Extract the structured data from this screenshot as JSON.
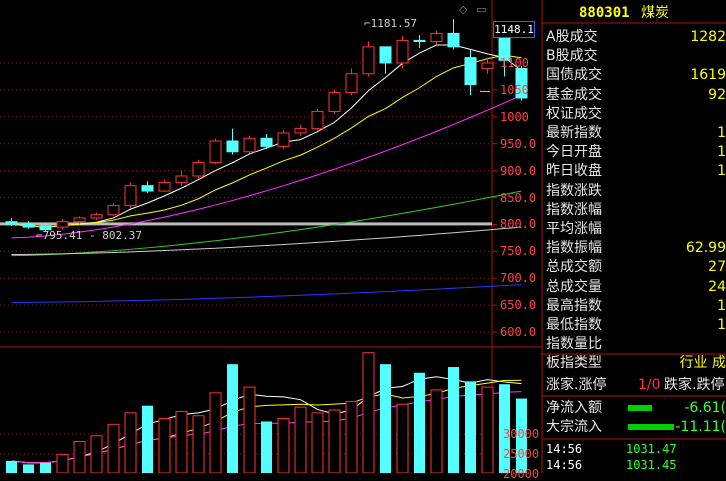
{
  "header": {
    "code": "880301",
    "name": "煤炭"
  },
  "price_badge": "1148.1",
  "high_annotation": "1181.57",
  "range_annotation": "795.41 - 802.37",
  "price_ticks": [
    "1100",
    "1050",
    "1000",
    "950.0",
    "900.0",
    "850.0",
    "800.0",
    "750.0",
    "700.0",
    "650.0",
    "600.0"
  ],
  "volume_ticks": [
    "30000",
    "25000",
    "20000"
  ],
  "stats": [
    {
      "label": "A股成交",
      "value": "1282"
    },
    {
      "label": "B股成交",
      "value": ""
    },
    {
      "label": "国债成交",
      "value": "1619"
    },
    {
      "label": "基金成交",
      "value": "92"
    },
    {
      "label": "权证成交",
      "value": ""
    },
    {
      "label": "最新指数",
      "value": "1"
    },
    {
      "label": "今日开盘",
      "value": "1"
    },
    {
      "label": "昨日收盘",
      "value": "1"
    },
    {
      "label": "指数涨跌",
      "value": ""
    },
    {
      "label": "指数涨幅",
      "value": ""
    },
    {
      "label": "平均涨幅",
      "value": ""
    },
    {
      "label": "指数振幅",
      "value": "62.99"
    },
    {
      "label": "总成交额",
      "value": "27"
    },
    {
      "label": "总成交量",
      "value": "24"
    },
    {
      "label": "最高指数",
      "value": "1"
    },
    {
      "label": "最低指数",
      "value": "1"
    },
    {
      "label": "指数量比",
      "value": ""
    },
    {
      "label": "板指类型",
      "value": "行业 成"
    }
  ],
  "updown": {
    "label": "涨家.涨停",
    "ratio": "1/0",
    "label2": "跌家.跌停"
  },
  "flows": [
    {
      "label": "净流入额",
      "value": "-6.61("
    },
    {
      "label": "大宗流入",
      "value": "-11.11("
    }
  ],
  "trades": [
    {
      "time": "14:56",
      "price": "1031.47"
    },
    {
      "time": "14:56",
      "price": "1031.45"
    }
  ],
  "colors": {
    "up": "#ff3232",
    "down": "#54ffff",
    "grid": "#8b1a1a",
    "yellow": "#ffff00",
    "ma5": "#ffffff",
    "ma10": "#ffff00",
    "ma20": "#ff33ff",
    "ma60": "#33cc33",
    "ma120": "#cccccc",
    "ma250": "#3333ff"
  },
  "chart_data": {
    "type": "candlestick",
    "price_axis": {
      "ticks": [
        1100,
        1050,
        1000,
        950,
        900,
        850,
        800,
        750,
        700,
        650,
        600
      ]
    },
    "candles": [
      {
        "o": 805,
        "h": 812,
        "c": 800,
        "l": 797
      },
      {
        "o": 800,
        "h": 806,
        "c": 795,
        "l": 792
      },
      {
        "o": 797,
        "h": 803,
        "c": 790,
        "l": 786
      },
      {
        "o": 795,
        "h": 810,
        "c": 805,
        "l": 790
      },
      {
        "o": 805,
        "h": 815,
        "c": 812,
        "l": 800
      },
      {
        "o": 812,
        "h": 822,
        "c": 818,
        "l": 808
      },
      {
        "o": 818,
        "h": 840,
        "c": 835,
        "l": 815
      },
      {
        "o": 835,
        "h": 878,
        "c": 872,
        "l": 830
      },
      {
        "o": 872,
        "h": 880,
        "c": 862,
        "l": 858
      },
      {
        "o": 862,
        "h": 882,
        "c": 878,
        "l": 860
      },
      {
        "o": 878,
        "h": 900,
        "c": 890,
        "l": 872
      },
      {
        "o": 890,
        "h": 920,
        "c": 915,
        "l": 885
      },
      {
        "o": 915,
        "h": 960,
        "c": 955,
        "l": 912
      },
      {
        "o": 955,
        "h": 978,
        "c": 935,
        "l": 930
      },
      {
        "o": 935,
        "h": 965,
        "c": 960,
        "l": 932
      },
      {
        "o": 960,
        "h": 968,
        "c": 945,
        "l": 940
      },
      {
        "o": 945,
        "h": 975,
        "c": 970,
        "l": 940
      },
      {
        "o": 970,
        "h": 985,
        "c": 978,
        "l": 965
      },
      {
        "o": 978,
        "h": 1015,
        "c": 1010,
        "l": 975
      },
      {
        "o": 1010,
        "h": 1050,
        "c": 1045,
        "l": 1005
      },
      {
        "o": 1045,
        "h": 1090,
        "c": 1080,
        "l": 1040
      },
      {
        "o": 1080,
        "h": 1140,
        "c": 1130,
        "l": 1075
      },
      {
        "o": 1130,
        "h": 1120,
        "c": 1100,
        "l": 1080
      },
      {
        "o": 1100,
        "h": 1150,
        "c": 1142,
        "l": 1090
      },
      {
        "o": 1142,
        "h": 1152,
        "c": 1140,
        "l": 1128
      },
      {
        "o": 1140,
        "h": 1160,
        "c": 1155,
        "l": 1135
      },
      {
        "o": 1155,
        "h": 1181.57,
        "c": 1130,
        "l": 1125
      },
      {
        "o": 1110,
        "h": 1125,
        "c": 1060,
        "l": 1040
      },
      {
        "o": 1090,
        "h": 1110,
        "c": 1100,
        "l": 1080
      },
      {
        "o": 1148,
        "h": 1160,
        "c": 1105,
        "l": 1075
      },
      {
        "o": 1090,
        "h": 1095,
        "c": 1035,
        "l": 1030
      }
    ],
    "volumes": [
      4200,
      3000,
      3500,
      6500,
      11000,
      13000,
      17000,
      21000,
      23500,
      19000,
      21500,
      20000,
      28000,
      38000,
      30000,
      18000,
      19000,
      23000,
      21000,
      22000,
      25000,
      42000,
      38000,
      24000,
      35000,
      29000,
      37000,
      32000,
      30000,
      31000,
      26000
    ],
    "volume_axis": {
      "ticks": [
        30000,
        25000,
        20000
      ]
    }
  }
}
